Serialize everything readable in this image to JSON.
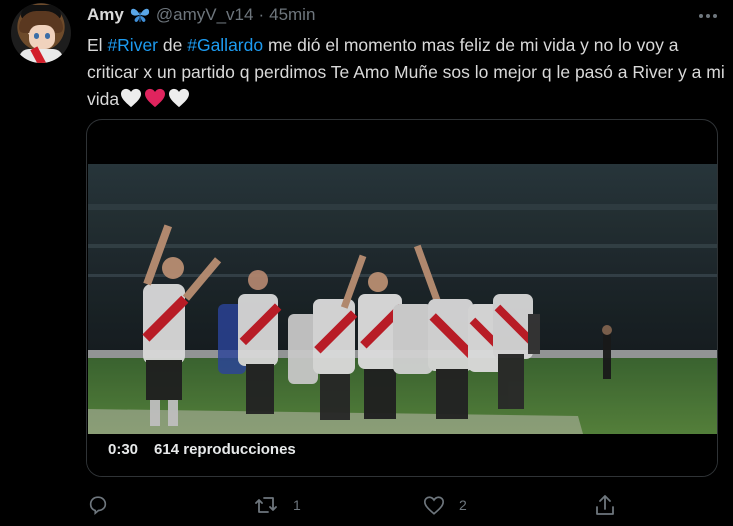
{
  "author": {
    "name": "Amy",
    "badge_icon": "butterfly-icon",
    "handle": "@amyV_v14",
    "separator": "·",
    "time": "45min"
  },
  "tweet": {
    "segments": [
      {
        "text": "El ",
        "type": "text"
      },
      {
        "text": "#River",
        "type": "hashtag"
      },
      {
        "text": " de ",
        "type": "text"
      },
      {
        "text": "#Gallardo",
        "type": "hashtag"
      },
      {
        "text": " me dió el momento mas feliz de mi vida y no lo voy a criticar x un partido q perdimos Te Amo Muñe sos lo mejor q le pasó a River y a mi vida",
        "type": "text"
      }
    ],
    "emojis": [
      "white-heart-icon",
      "red-heart-icon",
      "white-heart-icon"
    ]
  },
  "media": {
    "duration": "0:30",
    "views": "614 reproducciones"
  },
  "actions": {
    "reply": {
      "icon": "reply-icon",
      "count": ""
    },
    "retweet": {
      "icon": "retweet-icon",
      "count": "1"
    },
    "like": {
      "icon": "heart-outline-icon",
      "count": "2"
    },
    "share": {
      "icon": "share-icon"
    }
  },
  "colors": {
    "background": "#000000",
    "text": "#d9d9d9",
    "secondary": "#6e767d",
    "link": "#1d9bf0",
    "heart_red": "#e0245e",
    "butterfly": "#5aa7e8"
  }
}
